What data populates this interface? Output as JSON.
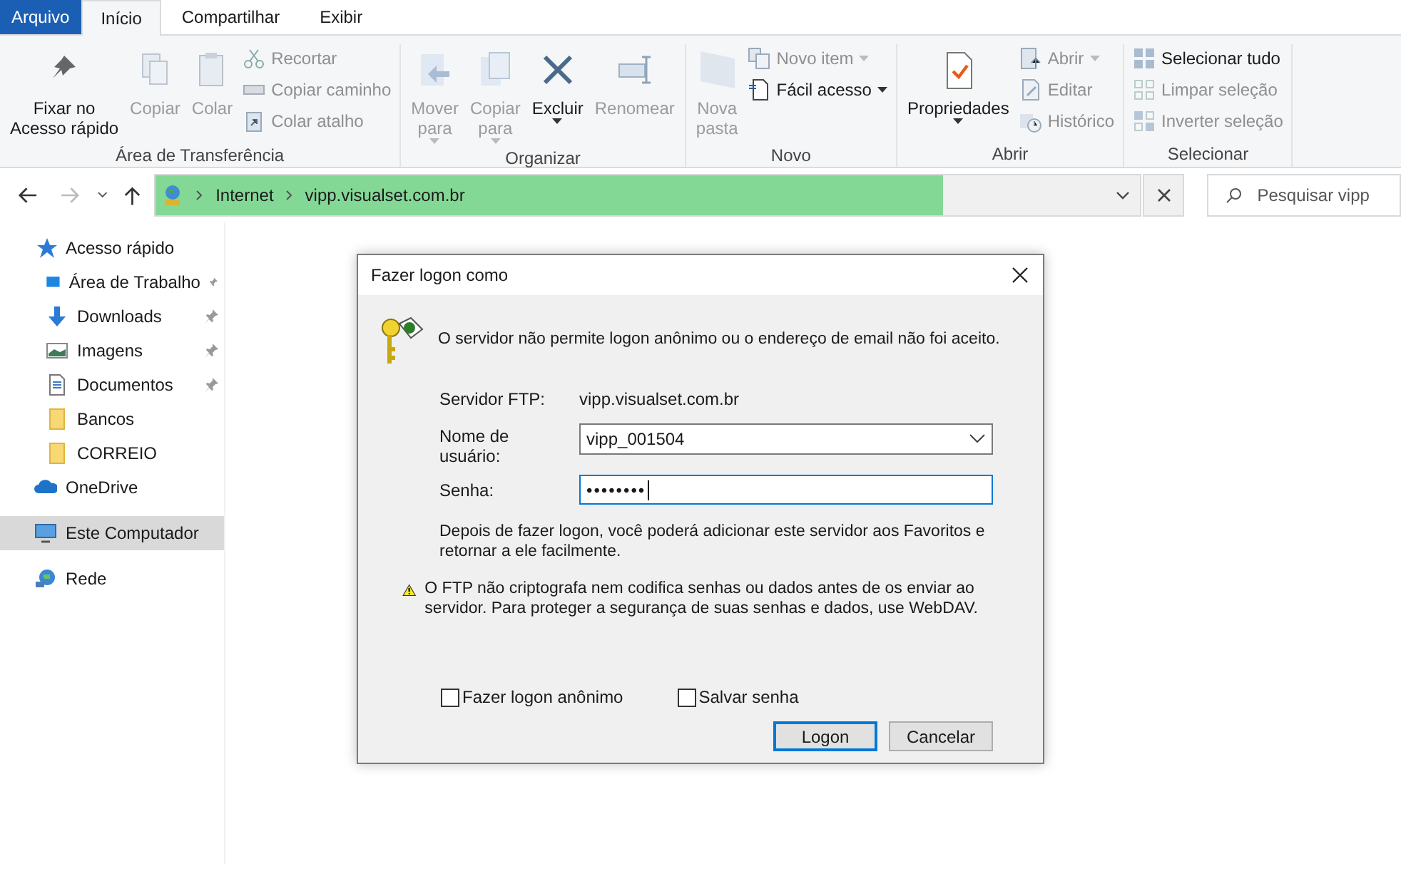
{
  "ribbon_tabs": [
    {
      "label": "Arquivo",
      "kind": "file",
      "selected": false
    },
    {
      "label": "Início",
      "kind": "tab",
      "selected": true
    },
    {
      "label": "Compartilhar",
      "kind": "tab",
      "selected": false
    },
    {
      "label": "Exibir",
      "kind": "tab",
      "selected": false
    }
  ],
  "ribbon_groups": [
    {
      "label": "Área de Transferência",
      "items": [
        {
          "kind": "large",
          "label": "Fixar no\nAcesso rápido",
          "disabled": false,
          "has_menu": false
        },
        {
          "kind": "large",
          "label": "Copiar",
          "disabled": true,
          "has_menu": false
        },
        {
          "kind": "large",
          "label": "Colar",
          "disabled": true,
          "has_menu": false
        },
        {
          "kind": "stack",
          "items": [
            {
              "label": "Recortar",
              "disabled": true,
              "has_menu": false
            },
            {
              "label": "Copiar caminho",
              "disabled": true,
              "has_menu": false
            },
            {
              "label": "Colar atalho",
              "disabled": true,
              "has_menu": false
            }
          ]
        }
      ]
    },
    {
      "label": "Organizar",
      "items": [
        {
          "kind": "large",
          "label": "Mover\npara",
          "disabled": true,
          "has_menu": true
        },
        {
          "kind": "large",
          "label": "Copiar\npara",
          "disabled": true,
          "has_menu": true
        },
        {
          "kind": "large",
          "label": "Excluir",
          "disabled": false,
          "has_menu": true
        },
        {
          "kind": "large",
          "label": "Renomear",
          "disabled": true,
          "has_menu": false
        }
      ]
    },
    {
      "label": "Novo",
      "items": [
        {
          "kind": "large",
          "label": "Nova\npasta",
          "disabled": true,
          "has_menu": false
        },
        {
          "kind": "stack",
          "items": [
            {
              "label": "Novo item",
              "disabled": true,
              "has_menu": true
            },
            {
              "label": "Fácil acesso",
              "disabled": false,
              "has_menu": true
            }
          ]
        }
      ]
    },
    {
      "label": "Abrir",
      "items": [
        {
          "kind": "large",
          "label": "Propriedades",
          "disabled": false,
          "has_menu": true
        },
        {
          "kind": "stack",
          "items": [
            {
              "label": "Abrir",
              "disabled": true,
              "has_menu": true
            },
            {
              "label": "Editar",
              "disabled": true,
              "has_menu": false
            },
            {
              "label": "Histórico",
              "disabled": true,
              "has_menu": false
            }
          ]
        }
      ]
    },
    {
      "label": "Selecionar",
      "items": [
        {
          "kind": "stack",
          "items": [
            {
              "label": "Selecionar tudo",
              "disabled": false,
              "has_menu": false
            },
            {
              "label": "Limpar seleção",
              "disabled": true,
              "has_menu": false
            },
            {
              "label": "Inverter seleção",
              "disabled": true,
              "has_menu": false
            }
          ]
        }
      ]
    }
  ],
  "address_bar": {
    "crumbs": [
      "Internet",
      "vipp.visualset.com.br"
    ],
    "level": 0.8
  },
  "search": {
    "placeholder": "Pesquisar vipp"
  },
  "sidebar": {
    "items": [
      {
        "label": "Acesso rápido",
        "selected": false,
        "children": [
          {
            "label": "Área de Trabalho",
            "pinned": true,
            "selected": false
          },
          {
            "label": "Downloads",
            "pinned": true,
            "selected": false
          },
          {
            "label": "Imagens",
            "pinned": true,
            "selected": false
          },
          {
            "label": "Documentos",
            "pinned": true,
            "selected": false
          },
          {
            "label": "Bancos",
            "pinned": false,
            "selected": false
          },
          {
            "label": "CORREIO",
            "pinned": false,
            "selected": false
          }
        ]
      },
      {
        "label": "OneDrive",
        "selected": false
      },
      {
        "label": "Este Computador",
        "selected": true
      },
      {
        "label": "Rede",
        "selected": false
      }
    ]
  },
  "dialog": {
    "title": "Fazer logon como",
    "message": "O servidor não permite logon anônimo ou o endereço de email não foi aceito.",
    "server_label": "Servidor FTP:",
    "server_value": "vipp.visualset.com.br",
    "username_label": "Nome de usuário:",
    "username_value": "vipp_001504",
    "password_label": "Senha:",
    "password_value": "••••••••",
    "info": "Depois de fazer logon, você poderá adicionar este servidor aos Favoritos e retornar a ele facilmente.",
    "warning": "O FTP não criptografa nem codifica senhas ou dados antes de os enviar ao servidor. Para proteger a segurança de suas senhas e dados, use WebDAV.",
    "checkboxes": [
      {
        "label": "Fazer logon anônimo",
        "checked": false
      },
      {
        "label": "Salvar senha",
        "checked": false
      }
    ],
    "buttons": [
      {
        "label": "Logon",
        "default": true
      },
      {
        "label": "Cancelar",
        "default": false
      }
    ]
  }
}
